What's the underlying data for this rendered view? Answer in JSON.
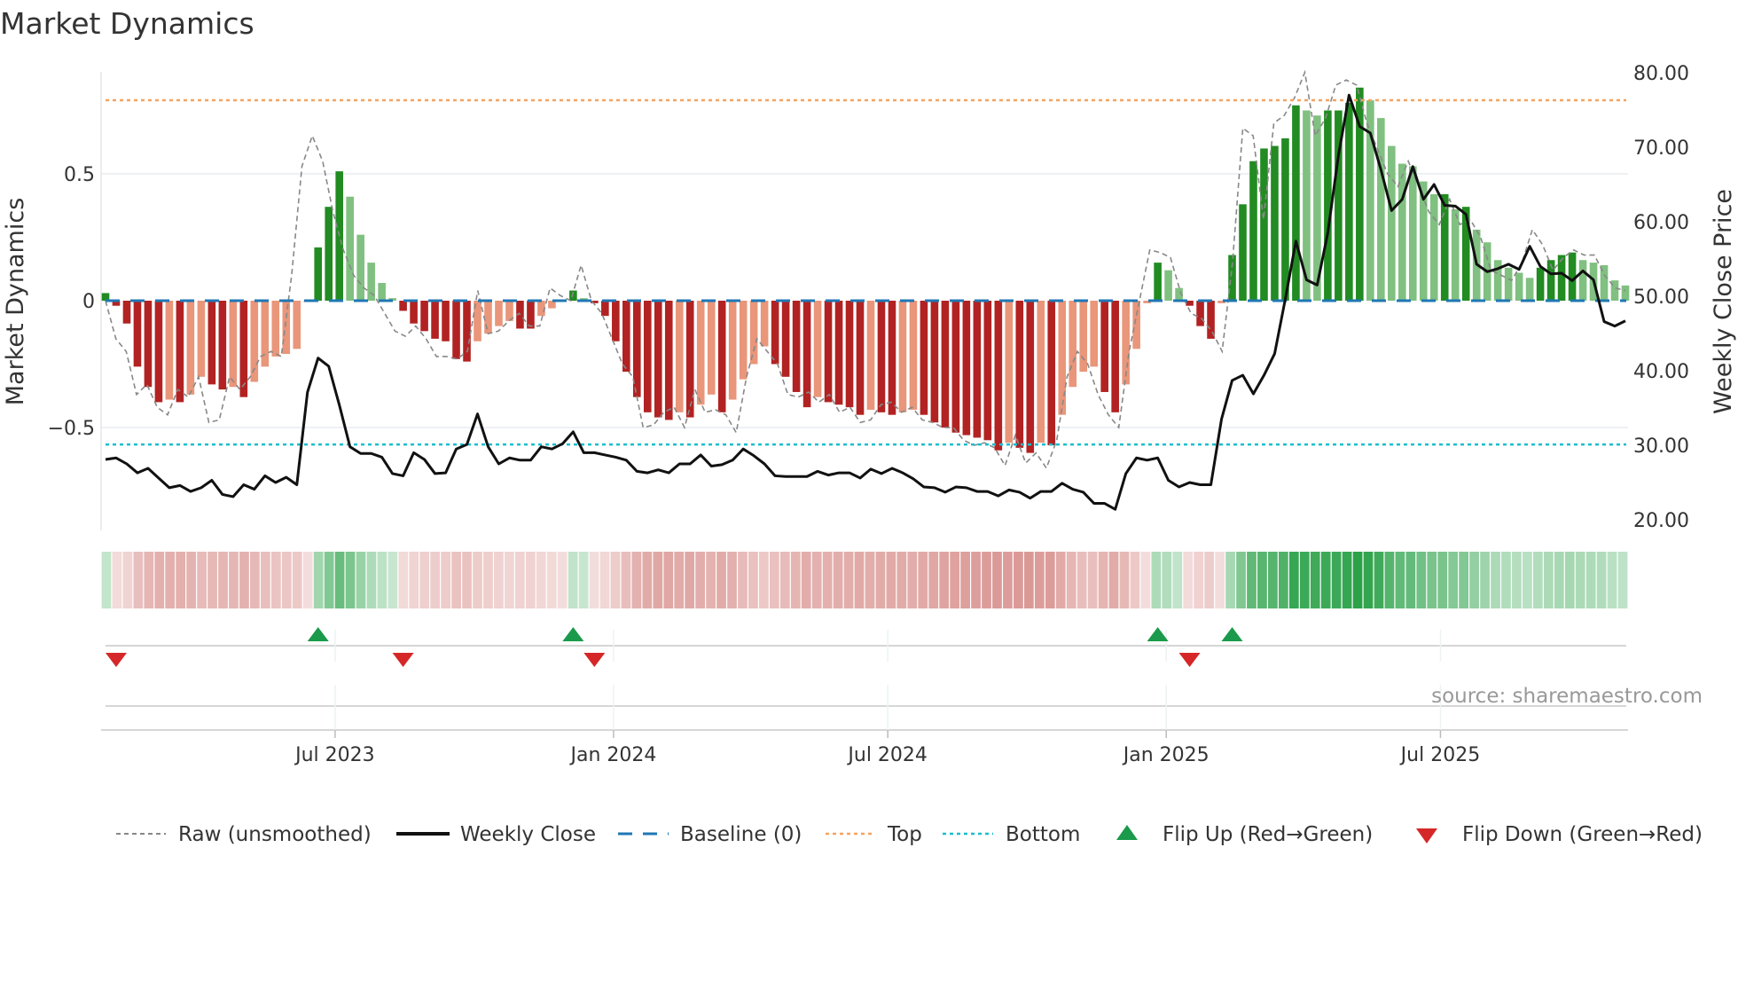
{
  "chart_data": {
    "type": "bar",
    "title": "Market Dynamics",
    "ylabel": "Market Dynamics",
    "y2label": "Weekly Close Price",
    "ylim": [
      -0.82,
      0.9
    ],
    "y2lim": [
      17,
      85
    ],
    "yticks": [
      {
        "value": 0.5,
        "label": "0.5"
      },
      {
        "value": 0,
        "label": "0"
      },
      {
        "value": -0.5,
        "label": "−0.5"
      }
    ],
    "y2ticks": [
      {
        "value": 80,
        "label": "80.00"
      },
      {
        "value": 70,
        "label": "70.00"
      },
      {
        "value": 60,
        "label": "60.00"
      },
      {
        "value": 50,
        "label": "50.00"
      },
      {
        "value": 40,
        "label": "40.00"
      },
      {
        "value": 30,
        "label": "30.00"
      },
      {
        "value": 20,
        "label": "20.00"
      }
    ],
    "xticks": [
      {
        "week": 21.6,
        "label": "Jul 2023"
      },
      {
        "week": 47.8,
        "label": "Jan 2024"
      },
      {
        "week": 73.6,
        "label": "Jul 2024"
      },
      {
        "week": 99.8,
        "label": "Jan 2025"
      },
      {
        "week": 125.6,
        "label": "Jul 2025"
      }
    ],
    "levels": {
      "top": 0.79,
      "bottom": -0.567,
      "baseline": 0
    },
    "dynamics": [
      0.03,
      -0.02,
      -0.09,
      -0.26,
      -0.34,
      -0.4,
      -0.39,
      -0.4,
      -0.37,
      -0.3,
      -0.33,
      -0.35,
      -0.34,
      -0.38,
      -0.32,
      -0.26,
      -0.22,
      -0.21,
      -0.19,
      -0.005,
      0.21,
      0.37,
      0.51,
      0.41,
      0.26,
      0.15,
      0.07,
      0.01,
      -0.04,
      -0.09,
      -0.12,
      -0.15,
      -0.16,
      -0.23,
      -0.24,
      -0.16,
      -0.13,
      -0.1,
      -0.08,
      -0.11,
      -0.11,
      -0.06,
      -0.03,
      -0.005,
      0.04,
      0.01,
      -0.01,
      -0.06,
      -0.16,
      -0.28,
      -0.38,
      -0.44,
      -0.46,
      -0.47,
      -0.44,
      -0.46,
      -0.41,
      -0.37,
      -0.44,
      -0.39,
      -0.31,
      -0.25,
      -0.18,
      -0.25,
      -0.3,
      -0.36,
      -0.42,
      -0.38,
      -0.4,
      -0.41,
      -0.42,
      -0.45,
      -0.43,
      -0.44,
      -0.45,
      -0.44,
      -0.43,
      -0.45,
      -0.48,
      -0.5,
      -0.52,
      -0.53,
      -0.54,
      -0.55,
      -0.59,
      -0.56,
      -0.58,
      -0.6,
      -0.56,
      -0.57,
      -0.45,
      -0.34,
      -0.28,
      -0.26,
      -0.36,
      -0.44,
      -0.33,
      -0.19,
      -0.01,
      0.15,
      0.12,
      0.05,
      -0.02,
      -0.1,
      -0.15,
      -0.01,
      0.18,
      0.38,
      0.55,
      0.6,
      0.61,
      0.64,
      0.77,
      0.75,
      0.73,
      0.75,
      0.75,
      0.78,
      0.84,
      0.79,
      0.72,
      0.61,
      0.54,
      0.53,
      0.47,
      0.42,
      0.42,
      0.36,
      0.37,
      0.28,
      0.23,
      0.16,
      0.13,
      0.11,
      0.09,
      0.13,
      0.16,
      0.18,
      0.19,
      0.16,
      0.15,
      0.14,
      0.08,
      0.06
    ],
    "raw": [
      0.0,
      -0.15,
      -0.2,
      -0.37,
      -0.33,
      -0.42,
      -0.45,
      -0.35,
      -0.38,
      -0.3,
      -0.48,
      -0.47,
      -0.3,
      -0.35,
      -0.3,
      -0.22,
      -0.2,
      -0.22,
      0.1,
      0.53,
      0.65,
      0.55,
      0.35,
      0.2,
      0.1,
      0.05,
      0.02,
      -0.05,
      -0.12,
      -0.14,
      -0.1,
      -0.15,
      -0.22,
      -0.22,
      -0.23,
      -0.2,
      0.04,
      -0.13,
      -0.12,
      -0.08,
      -0.05,
      -0.1,
      -0.1,
      0.05,
      0.02,
      0.0,
      0.14,
      0.0,
      -0.05,
      -0.15,
      -0.25,
      -0.3,
      -0.5,
      -0.49,
      -0.44,
      -0.42,
      -0.5,
      -0.35,
      -0.44,
      -0.43,
      -0.45,
      -0.52,
      -0.3,
      -0.15,
      -0.2,
      -0.25,
      -0.37,
      -0.38,
      -0.36,
      -0.4,
      -0.37,
      -0.44,
      -0.42,
      -0.48,
      -0.47,
      -0.41,
      -0.4,
      -0.44,
      -0.42,
      -0.47,
      -0.48,
      -0.5,
      -0.5,
      -0.55,
      -0.57,
      -0.56,
      -0.58,
      -0.65,
      -0.53,
      -0.64,
      -0.6,
      -0.66,
      -0.55,
      -0.3,
      -0.2,
      -0.25,
      -0.37,
      -0.45,
      -0.5,
      -0.2,
      0.0,
      0.2,
      0.19,
      0.17,
      0.03,
      -0.05,
      -0.07,
      -0.12,
      -0.2,
      0.15,
      0.68,
      0.65,
      0.32,
      0.7,
      0.73,
      0.8,
      0.9,
      0.65,
      0.72,
      0.85,
      0.87,
      0.85,
      0.7,
      0.6,
      0.5,
      0.45,
      0.55,
      0.45,
      0.35,
      0.3,
      0.4,
      0.3,
      0.32,
      0.25,
      0.12,
      0.1,
      0.08,
      0.15,
      0.28,
      0.22,
      0.12,
      0.17,
      0.2,
      0.18,
      0.18,
      0.1,
      0.05,
      0.04
    ],
    "close": [
      28.1,
      28.3,
      27.5,
      26.3,
      26.9,
      25.6,
      24.3,
      24.6,
      23.8,
      24.3,
      25.3,
      23.4,
      23.1,
      24.7,
      24.1,
      25.9,
      25.0,
      25.7,
      24.7,
      37.1,
      41.7,
      40.6,
      35.4,
      29.8,
      28.9,
      28.9,
      28.4,
      26.2,
      25.9,
      29.0,
      28.1,
      26.2,
      26.3,
      29.5,
      30.1,
      34.2,
      29.8,
      27.5,
      28.3,
      28.0,
      28.0,
      29.8,
      29.5,
      30.2,
      31.8,
      29.0,
      29.0,
      28.7,
      28.4,
      28.0,
      26.5,
      26.3,
      26.7,
      26.3,
      27.5,
      27.5,
      28.7,
      27.2,
      27.4,
      28.0,
      29.5,
      28.6,
      27.5,
      25.9,
      25.8,
      25.8,
      25.8,
      26.5,
      26.0,
      26.3,
      26.3,
      25.6,
      26.8,
      26.2,
      26.9,
      26.3,
      25.5,
      24.4,
      24.3,
      23.7,
      24.4,
      24.3,
      23.8,
      23.8,
      23.2,
      24.0,
      23.7,
      22.9,
      23.8,
      23.8,
      24.9,
      24.1,
      23.7,
      22.2,
      22.2,
      21.4,
      26.2,
      28.3,
      28.0,
      28.3,
      25.3,
      24.4,
      25.0,
      24.7,
      24.7,
      33.5,
      38.7,
      39.4,
      36.9,
      39.4,
      42.3,
      49.6,
      57.4,
      52.2,
      51.5,
      58.5,
      68.9,
      77.0,
      72.8,
      71.9,
      67.0,
      61.5,
      63.0,
      67.4,
      63.0,
      65.0,
      62.2,
      62.1,
      61.0,
      54.3,
      53.3,
      53.7,
      54.3,
      53.6,
      56.7,
      54.0,
      53.0,
      53.1,
      52.1,
      53.4,
      52.2,
      46.6,
      46.0,
      46.7
    ],
    "legend": {
      "raw": "Raw (unsmoothed)",
      "close": "Weekly Close",
      "baseline": "Baseline (0)",
      "top": "Top",
      "bottom": "Bottom",
      "flip_up": "Flip Up (Red→Green)",
      "flip_down": "Flip Down (Green→Red)"
    },
    "legend_placement": "bottom",
    "colors": {
      "up_strong": "#228b22",
      "up_weak": "#80c080",
      "down_strong": "#b22222",
      "down_weak": "#e9967a",
      "close": "#111111",
      "raw": "#888888",
      "baseline": "#1f77b4",
      "top": "#f4a460",
      "bottom": "#17becf",
      "flip_up": "#1a9a4a",
      "flip_down": "#d62728"
    },
    "source": "source: sharemaestro.com"
  }
}
